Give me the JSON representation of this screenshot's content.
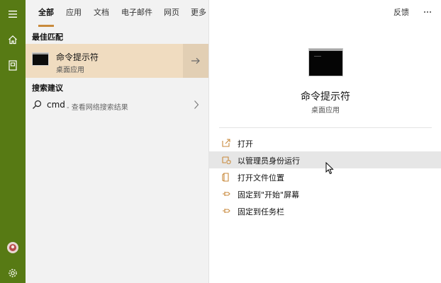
{
  "rail": {
    "icons": [
      "hamburger-menu-icon",
      "home-icon",
      "notebook-icon",
      "user-avatar",
      "settings-gear-icon"
    ],
    "accent": "#577a14"
  },
  "tabs": [
    {
      "label": "全部",
      "active": true
    },
    {
      "label": "应用"
    },
    {
      "label": "文档"
    },
    {
      "label": "电子邮件"
    },
    {
      "label": "网页"
    },
    {
      "label": "更多"
    }
  ],
  "header_right": {
    "feedback": "反馈",
    "more_icon": "ellipsis-icon"
  },
  "best_match": {
    "section_title": "最佳匹配",
    "name": "命令提示符",
    "type": "桌面应用",
    "highlight": "#f0dcc0",
    "arrow_icon": "arrow-right-icon"
  },
  "suggestions": {
    "section_title": "搜索建议",
    "items": [
      {
        "query": "cmd",
        "hint": "- 查看网络搜索结果"
      }
    ]
  },
  "preview": {
    "title": "命令提示符",
    "subtitle": "桌面应用",
    "actions": [
      {
        "label": "打开",
        "icon": "open-icon"
      },
      {
        "label": "以管理员身份运行",
        "icon": "run-as-admin-icon",
        "hovered": true
      },
      {
        "label": "打开文件位置",
        "icon": "file-location-icon"
      },
      {
        "label": "固定到\"开始\"屏幕",
        "icon": "pin-icon"
      },
      {
        "label": "固定到任务栏",
        "icon": "pin-icon"
      }
    ],
    "icon_color": "#c88a3c"
  }
}
